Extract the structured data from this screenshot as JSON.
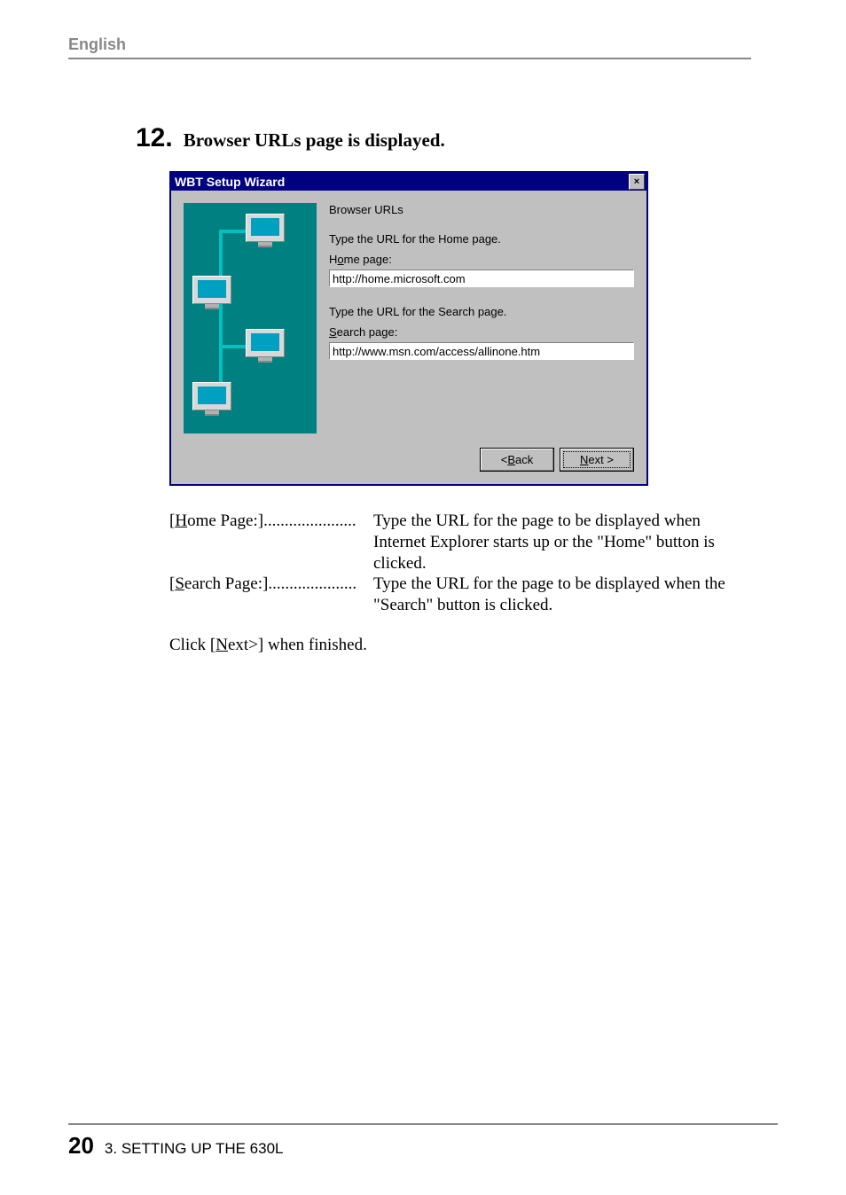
{
  "header": {
    "language": "English"
  },
  "step": {
    "number": "12.",
    "title": "Browser URLs page is displayed."
  },
  "wizard": {
    "title": "WBT Setup Wizard",
    "close_label": "×",
    "heading": "Browser URLs",
    "home_instruction": "Type the URL for the Home page.",
    "home_label_pre": "H",
    "home_label_mid": "o",
    "home_label_post": "me page:",
    "home_value": "http://home.microsoft.com",
    "search_instruction": "Type the URL for the Search page.",
    "search_label_pre": "",
    "search_label_mid": "S",
    "search_label_post": "earch page:",
    "search_value": "http://www.msn.com/access/allinone.htm",
    "back_pre": "< ",
    "back_mid": "B",
    "back_post": "ack",
    "next_mid": "N",
    "next_post": "ext >"
  },
  "descriptions": {
    "home_label_open": "[",
    "home_label_u": "H",
    "home_label_rest": "ome Page:]",
    "home_dots": "......................",
    "home_text_1": "Type the URL for the page to be displayed when",
    "home_text_2": "Internet Explorer starts up or the \"Home\" button is",
    "home_text_3": "clicked.",
    "search_label_open": "[",
    "search_label_u": "S",
    "search_label_rest": "earch Page:]",
    "search_dots": ".....................",
    "search_text_1": "Type the URL for the page to be displayed when the",
    "search_text_2": "\"Search\" button is clicked."
  },
  "finish": {
    "pre": "Click [",
    "u": "N",
    "post": "ext>] when finished."
  },
  "footer": {
    "page_number": "20",
    "section": "3. SETTING UP THE 630L"
  }
}
